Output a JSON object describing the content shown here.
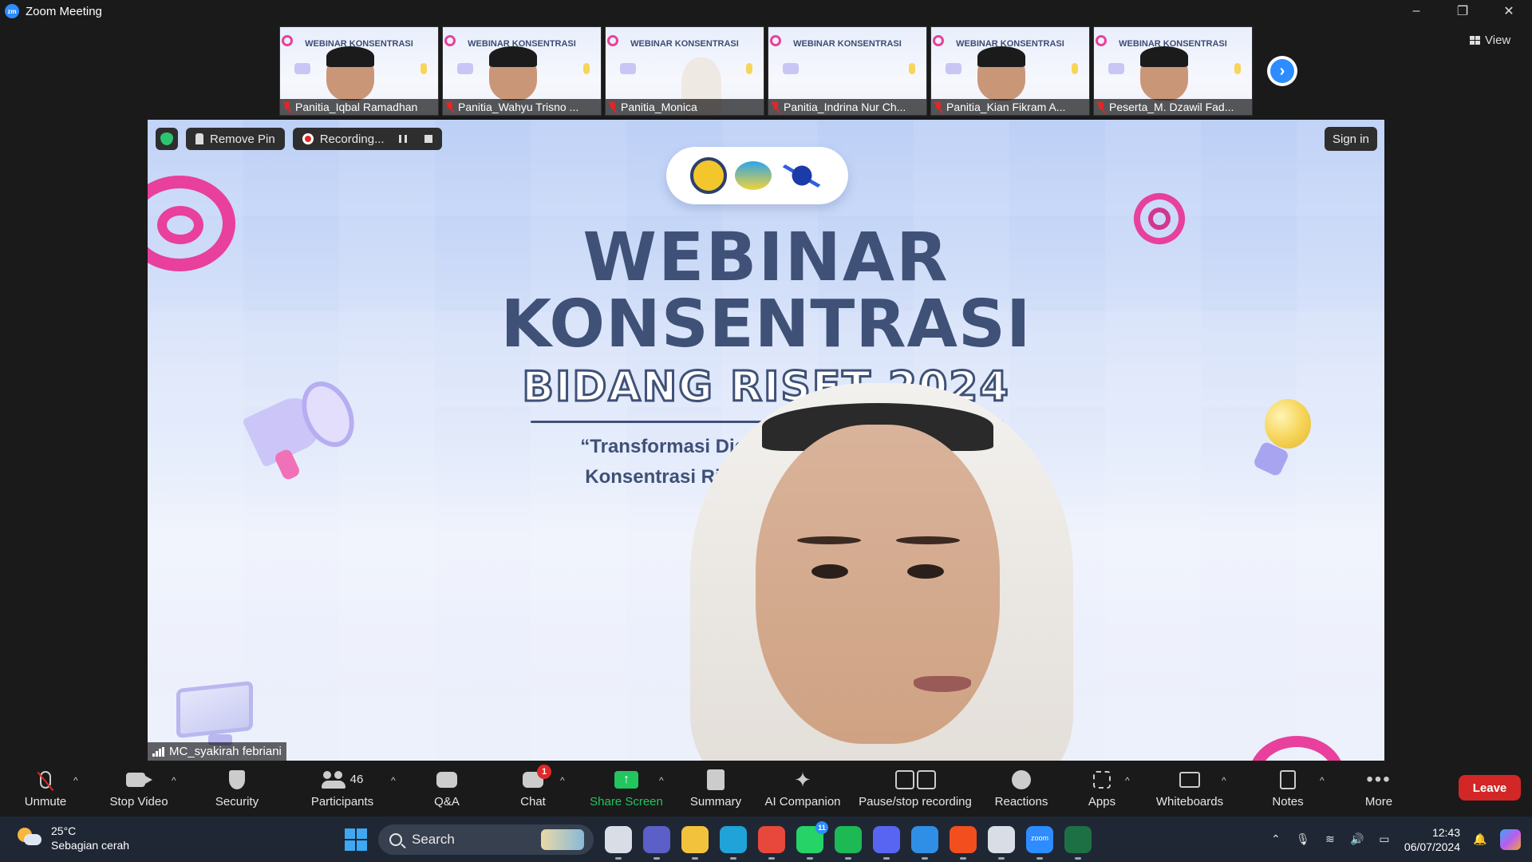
{
  "window": {
    "logo_text": "zm",
    "title": "Zoom Meeting",
    "controls": [
      "–",
      "❐",
      "✕"
    ]
  },
  "gallery": {
    "participants": [
      {
        "name": "Panitia_Iqbal Ramadhan",
        "muted": true,
        "look": "man"
      },
      {
        "name": "Panitia_Wahyu Trisno ...",
        "muted": true,
        "look": "man"
      },
      {
        "name": "Panitia_Monica",
        "muted": true,
        "look": "woman"
      },
      {
        "name": "Panitia_Indrina Nur Ch...",
        "muted": true,
        "look": "slide"
      },
      {
        "name": "Panitia_Kian Fikram A...",
        "muted": true,
        "look": "man"
      },
      {
        "name": "Peserta_M. Dzawil Fad...",
        "muted": true,
        "look": "man"
      }
    ],
    "thumb_title": "WEBINAR KONSENTRASI",
    "next_icon": "chevron-right-icon",
    "view_label": "View"
  },
  "stage": {
    "remove_pin_label": "Remove Pin",
    "recording_label": "Recording...",
    "sign_in_label": "Sign in",
    "speaker_name": "MC_syakirah febriani",
    "slide": {
      "line1": "WEBINAR",
      "line2": "KONSENTRASI",
      "line3": "BIDANG RISET 2024",
      "tagline1": "“Transformasi Digita                     Memilih",
      "tagline2": "Konsentrasi Riset                           ologi”"
    }
  },
  "toolbar": {
    "unmute": "Unmute",
    "stop_video": "Stop Video",
    "security": "Security",
    "participants": "Participants",
    "participants_count": "46",
    "qa": "Q&A",
    "chat": "Chat",
    "chat_badge": "1",
    "share_screen": "Share Screen",
    "summary": "Summary",
    "ai_companion": "AI Companion",
    "pause_stop_recording": "Pause/stop recording",
    "reactions": "Reactions",
    "apps": "Apps",
    "whiteboards": "Whiteboards",
    "notes": "Notes",
    "more": "More",
    "leave": "Leave",
    "colors": {
      "share_green": "#22c55e",
      "leave_red": "#d32626",
      "badge_red": "#e02828",
      "accent_blue": "#2d8cff"
    }
  },
  "taskbar": {
    "temperature": "25°C",
    "weather": "Sebagian cerah",
    "search_label": "Search",
    "apps": [
      {
        "name": "task-view-icon",
        "color": "#d8dde6"
      },
      {
        "name": "teams-icon",
        "color": "#5b5fc7"
      },
      {
        "name": "file-explorer-icon",
        "color": "#f3c23c"
      },
      {
        "name": "edge-icon",
        "color": "#1fa3d8"
      },
      {
        "name": "chrome-icon",
        "color": "#e8483b"
      },
      {
        "name": "whatsapp-icon",
        "color": "#25d366",
        "badge": "11"
      },
      {
        "name": "spotify-icon",
        "color": "#1db954"
      },
      {
        "name": "discord-icon",
        "color": "#5865f2"
      },
      {
        "name": "vscode-icon",
        "color": "#2f8fe6"
      },
      {
        "name": "figma-icon",
        "color": "#f24e1e"
      },
      {
        "name": "chatgpt-icon",
        "color": "#d8dde6"
      },
      {
        "name": "zoom-icon",
        "color": "#2d8cff",
        "label": "zoom"
      },
      {
        "name": "excel-icon",
        "color": "#1d7044"
      }
    ],
    "time": "12:43",
    "date": "06/07/2024"
  }
}
